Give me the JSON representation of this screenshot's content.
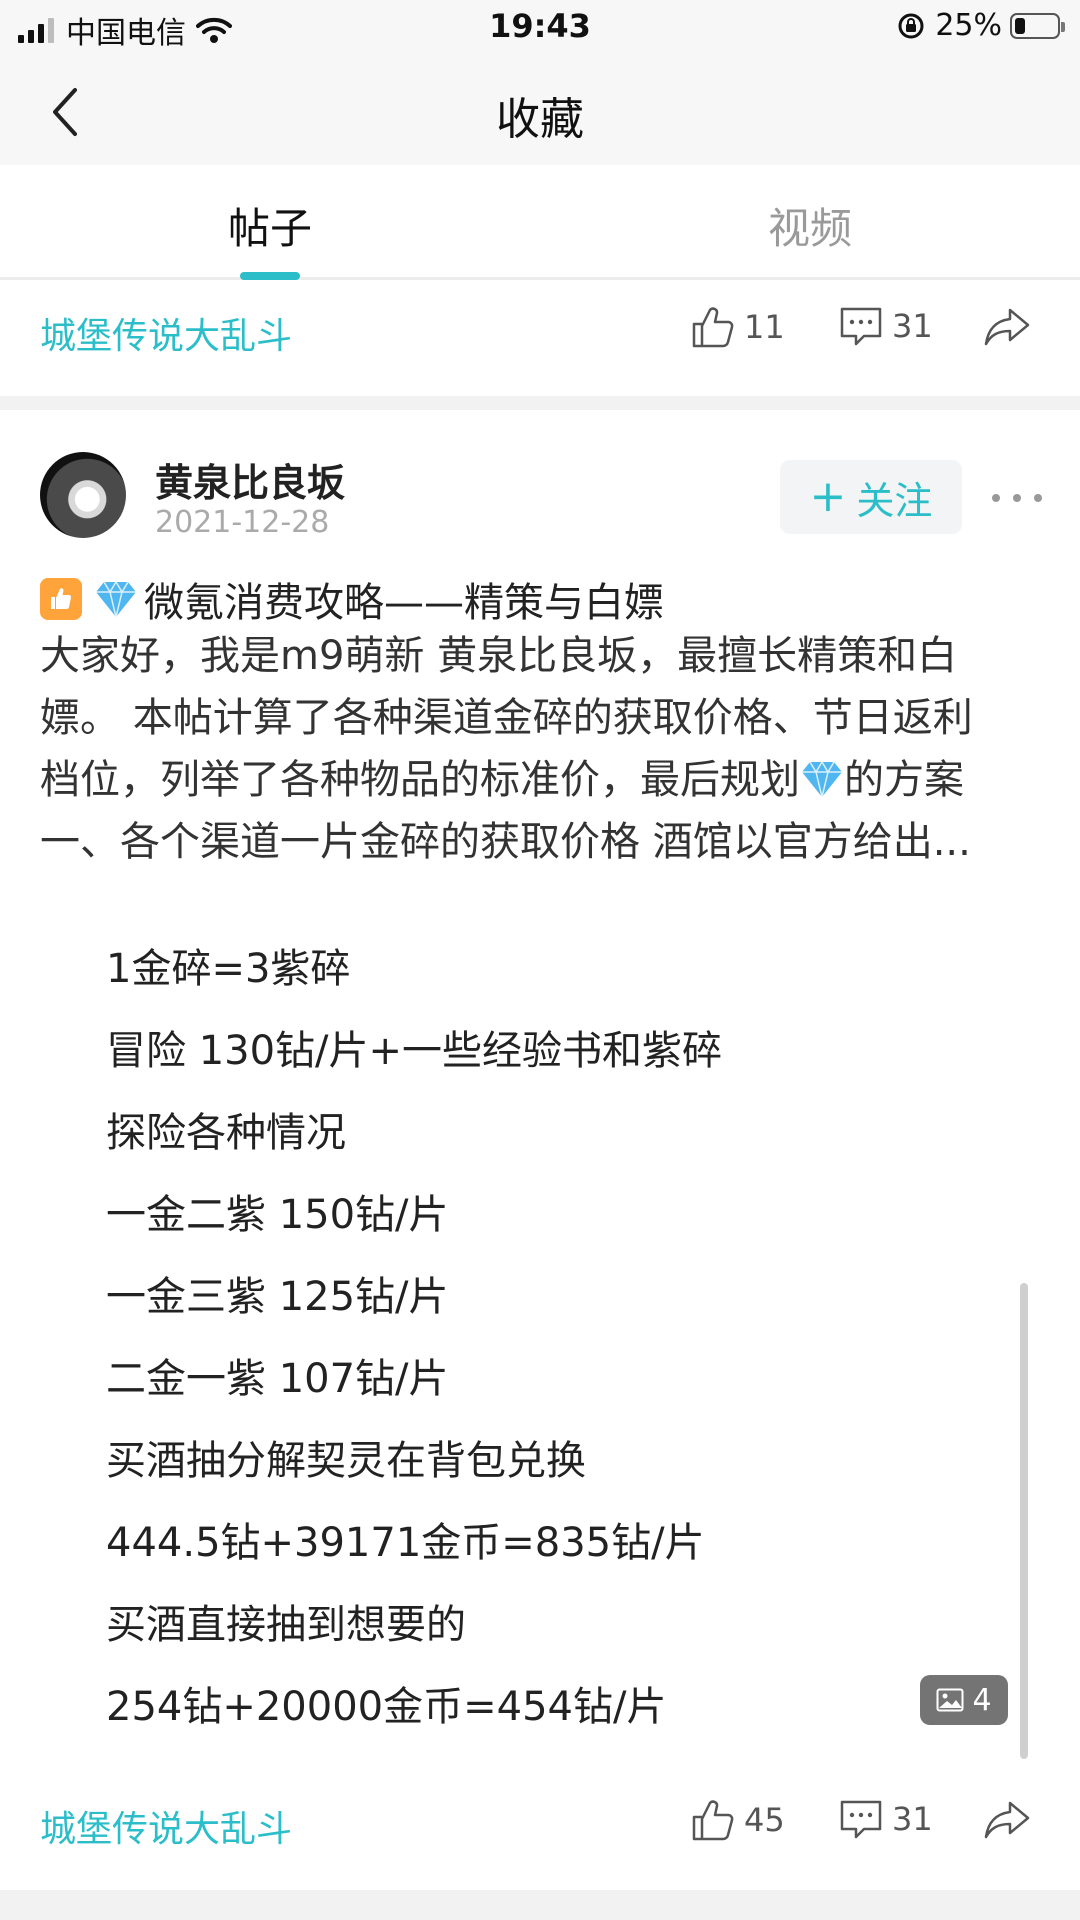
{
  "status_bar": {
    "carrier": "中国电信",
    "time": "19:43",
    "battery": "25%",
    "battery_level": 0.25
  },
  "nav": {
    "title": "收藏"
  },
  "tabs": [
    {
      "label": "帖子",
      "active": true
    },
    {
      "label": "视频",
      "active": false
    }
  ],
  "previous_post_footer": {
    "game": "城堡传说大乱斗",
    "likes": "11",
    "comments": "31"
  },
  "post": {
    "author": "黄泉比良坂",
    "date": "2021-12-28",
    "follow_label": "关注",
    "title": "微氪消费攻略——精策与白嫖",
    "excerpt_lines": [
      "大家好，我是m9萌新 黄泉比良坂，最擅长精策和白",
      "嫖。 本帖计算了各种渠道金碎的获取价格、节日返利",
      "档位，列举了各种物品的标准价，最后规划",
      "的方案",
      "一、各个渠道一片金碎的获取价格 酒馆以官方给出..."
    ],
    "body_lines": [
      "1金碎=3紫碎",
      "冒险 130钻/片+一些经验书和紫碎",
      "探险各种情况",
      "一金二紫 150钻/片",
      "一金三紫 125钻/片",
      "二金一紫 107钻/片",
      "买酒抽分解契灵在背包兑换",
      "444.5钻+39171金币=835钻/片",
      "买酒直接抽到想要的",
      "254钻+20000金币=454钻/片"
    ],
    "image_count": "4",
    "game": "城堡传说大乱斗",
    "likes": "45",
    "comments": "31"
  },
  "colors": {
    "accent": "#2bbec9",
    "badge_orange": "#ffa43a",
    "diamond": "#4fb6f0"
  },
  "icons": [
    "signal-icon",
    "wifi-icon",
    "rotation-lock-icon",
    "battery-icon",
    "back-arrow-icon",
    "thumbs-up-icon",
    "comment-icon",
    "share-icon",
    "more-icon",
    "diamond-icon",
    "image-icon"
  ]
}
